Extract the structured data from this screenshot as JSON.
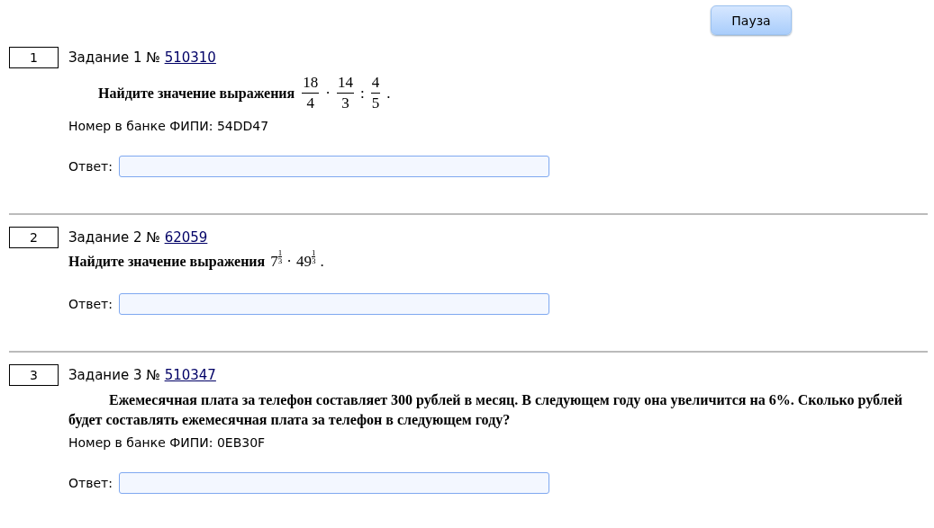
{
  "pause_button": {
    "label": "Пауза"
  },
  "tasks": [
    {
      "number": "1",
      "title": "Задание 1 №",
      "link": "510310",
      "statement": {
        "text": "Найдите значение выражения",
        "indent": true,
        "formula": [
          {
            "kind": "frac",
            "num": "18",
            "den": "4"
          },
          {
            "kind": "op",
            "text": "·"
          },
          {
            "kind": "frac",
            "num": "14",
            "den": "3"
          },
          {
            "kind": "op",
            "text": ":"
          },
          {
            "kind": "frac",
            "num": "4",
            "den": "5"
          },
          {
            "kind": "op",
            "text": "."
          }
        ]
      },
      "bank_id": "Номер в банке ФИПИ: 54DD47",
      "answer_label": "Ответ:"
    },
    {
      "number": "2",
      "title": "Задание 2 №",
      "link": "62059",
      "statement": {
        "text": "Найдите значение выражения",
        "indent": false,
        "formula": [
          {
            "kind": "pow",
            "base": "7",
            "num": "1",
            "den": "3"
          },
          {
            "kind": "op",
            "text": "·"
          },
          {
            "kind": "pow",
            "base": "49",
            "num": "1",
            "den": "3"
          },
          {
            "kind": "op",
            "text": "."
          }
        ]
      },
      "answer_label": "Ответ:"
    },
    {
      "number": "3",
      "title": "Задание 3 №",
      "link": "510347",
      "statement": {
        "text": "Ежемесячная плата за телефон составляет 300 рублей в месяц. В следующем году она увеличится на 6%. Сколько рублей будет составлять ежемесячная плата за телефон в следующем году?",
        "indent": true
      },
      "bank_id": "Номер в банке ФИПИ: 0EB30F",
      "answer_label": "Ответ:"
    }
  ]
}
